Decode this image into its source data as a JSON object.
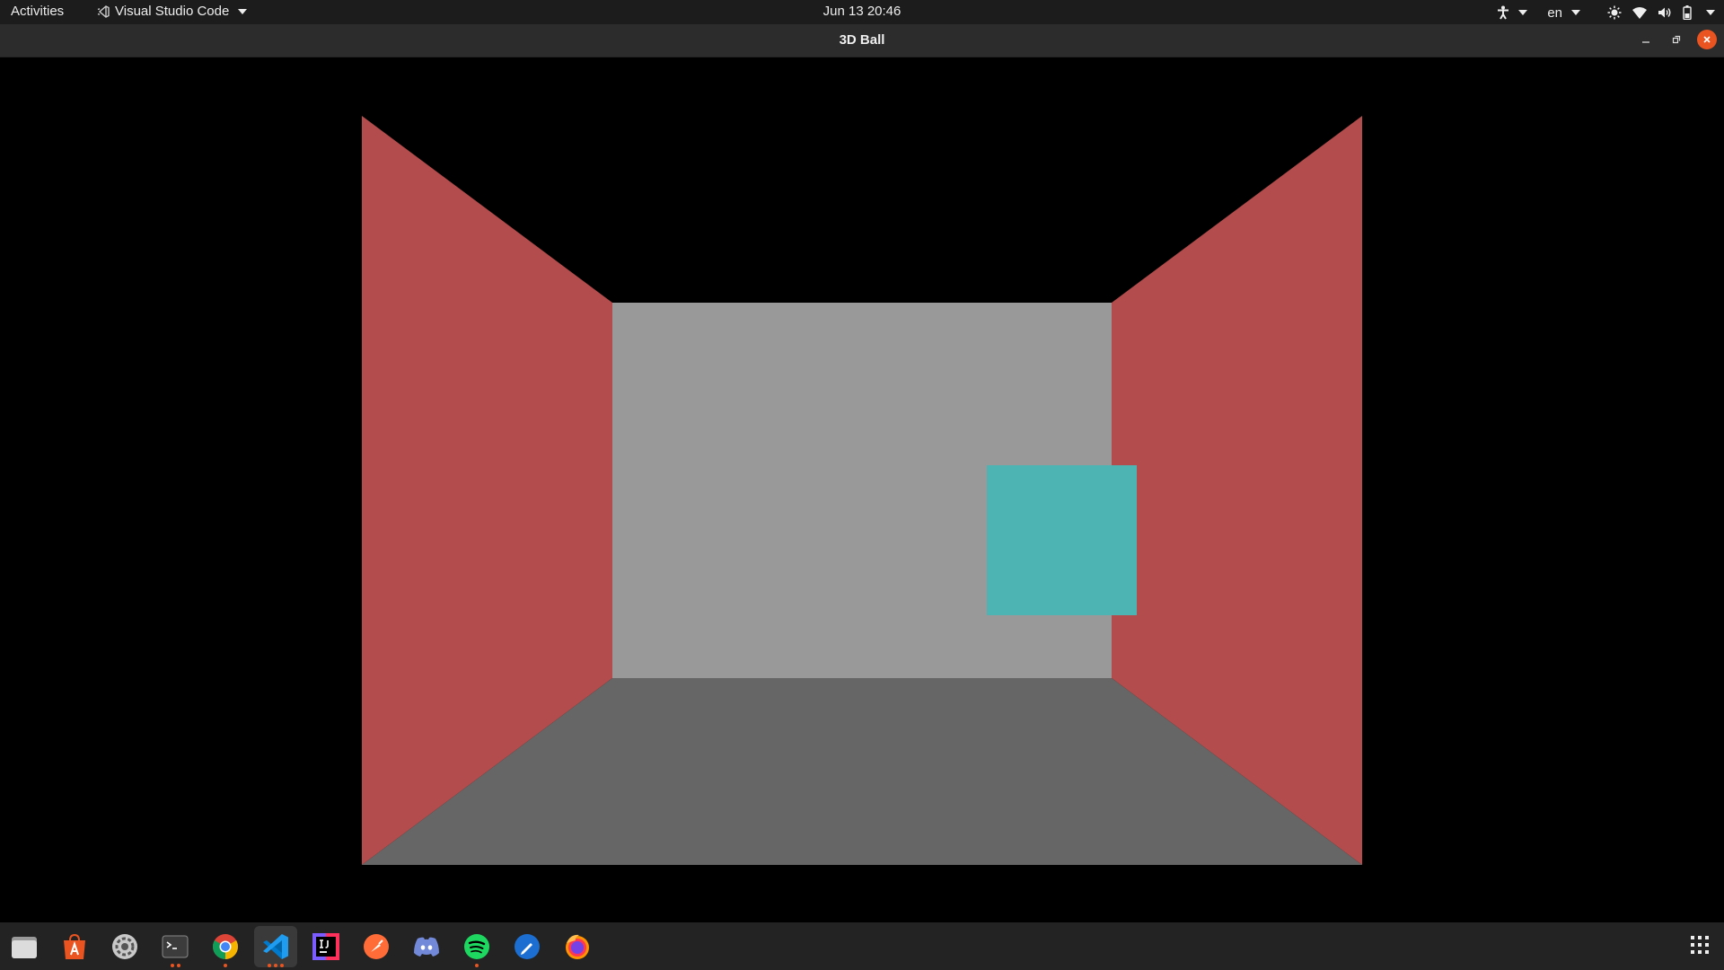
{
  "topbar": {
    "activities": "Activities",
    "app_name": "Visual Studio Code",
    "clock": "Jun 13  20:46",
    "language": "en"
  },
  "window": {
    "title": "3D Ball"
  },
  "scene": {
    "colors": {
      "background": "#000000",
      "side_walls": "#b34c4c",
      "back_wall": "#999999",
      "floor": "#666666",
      "cube": "#4db3b3"
    }
  },
  "dock": {
    "apps": [
      {
        "name": "Files",
        "icon": "files-icon"
      },
      {
        "name": "Ubuntu Software",
        "icon": "software-icon"
      },
      {
        "name": "Settings",
        "icon": "settings-icon"
      },
      {
        "name": "Terminal",
        "icon": "terminal-icon"
      },
      {
        "name": "Google Chrome",
        "icon": "chrome-icon"
      },
      {
        "name": "Visual Studio Code",
        "icon": "vscode-icon"
      },
      {
        "name": "IntelliJ IDEA",
        "icon": "intellij-icon"
      },
      {
        "name": "Postman",
        "icon": "postman-icon"
      },
      {
        "name": "Discord",
        "icon": "discord-icon"
      },
      {
        "name": "Spotify",
        "icon": "spotify-icon"
      },
      {
        "name": "Text Editor",
        "icon": "text-editor-icon"
      },
      {
        "name": "Firefox",
        "icon": "firefox-icon"
      }
    ],
    "show_apps_icon": "app-grid-icon"
  }
}
